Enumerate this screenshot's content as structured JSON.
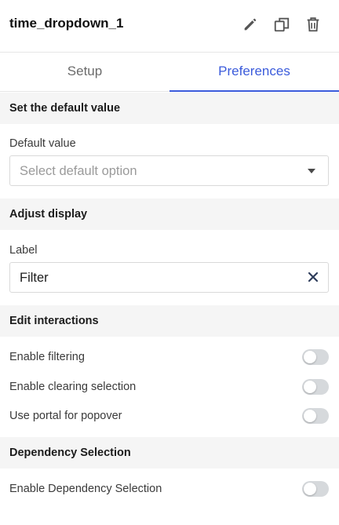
{
  "header": {
    "title": "time_dropdown_1",
    "icons": [
      "pencil-icon",
      "duplicate-icon",
      "trash-icon"
    ]
  },
  "tabs": [
    {
      "label": "Setup",
      "active": false
    },
    {
      "label": "Preferences",
      "active": true
    }
  ],
  "sections": {
    "default_value": {
      "title": "Set the default value",
      "field_label": "Default value",
      "select_placeholder": "Select default option",
      "select_value": ""
    },
    "display": {
      "title": "Adjust display",
      "field_label": "Label",
      "input_value": "Filter"
    },
    "interactions": {
      "title": "Edit interactions",
      "toggles": [
        {
          "label": "Enable filtering",
          "on": false
        },
        {
          "label": "Enable clearing selection",
          "on": false
        },
        {
          "label": "Use portal for popover",
          "on": false
        }
      ]
    },
    "dependency": {
      "title": "Dependency Selection",
      "toggles": [
        {
          "label": "Enable Dependency Selection",
          "on": false
        }
      ]
    }
  },
  "colors": {
    "accent": "#3b5bdb",
    "section_bg": "#f5f5f5",
    "toggle_off": "#d6d9dc"
  }
}
